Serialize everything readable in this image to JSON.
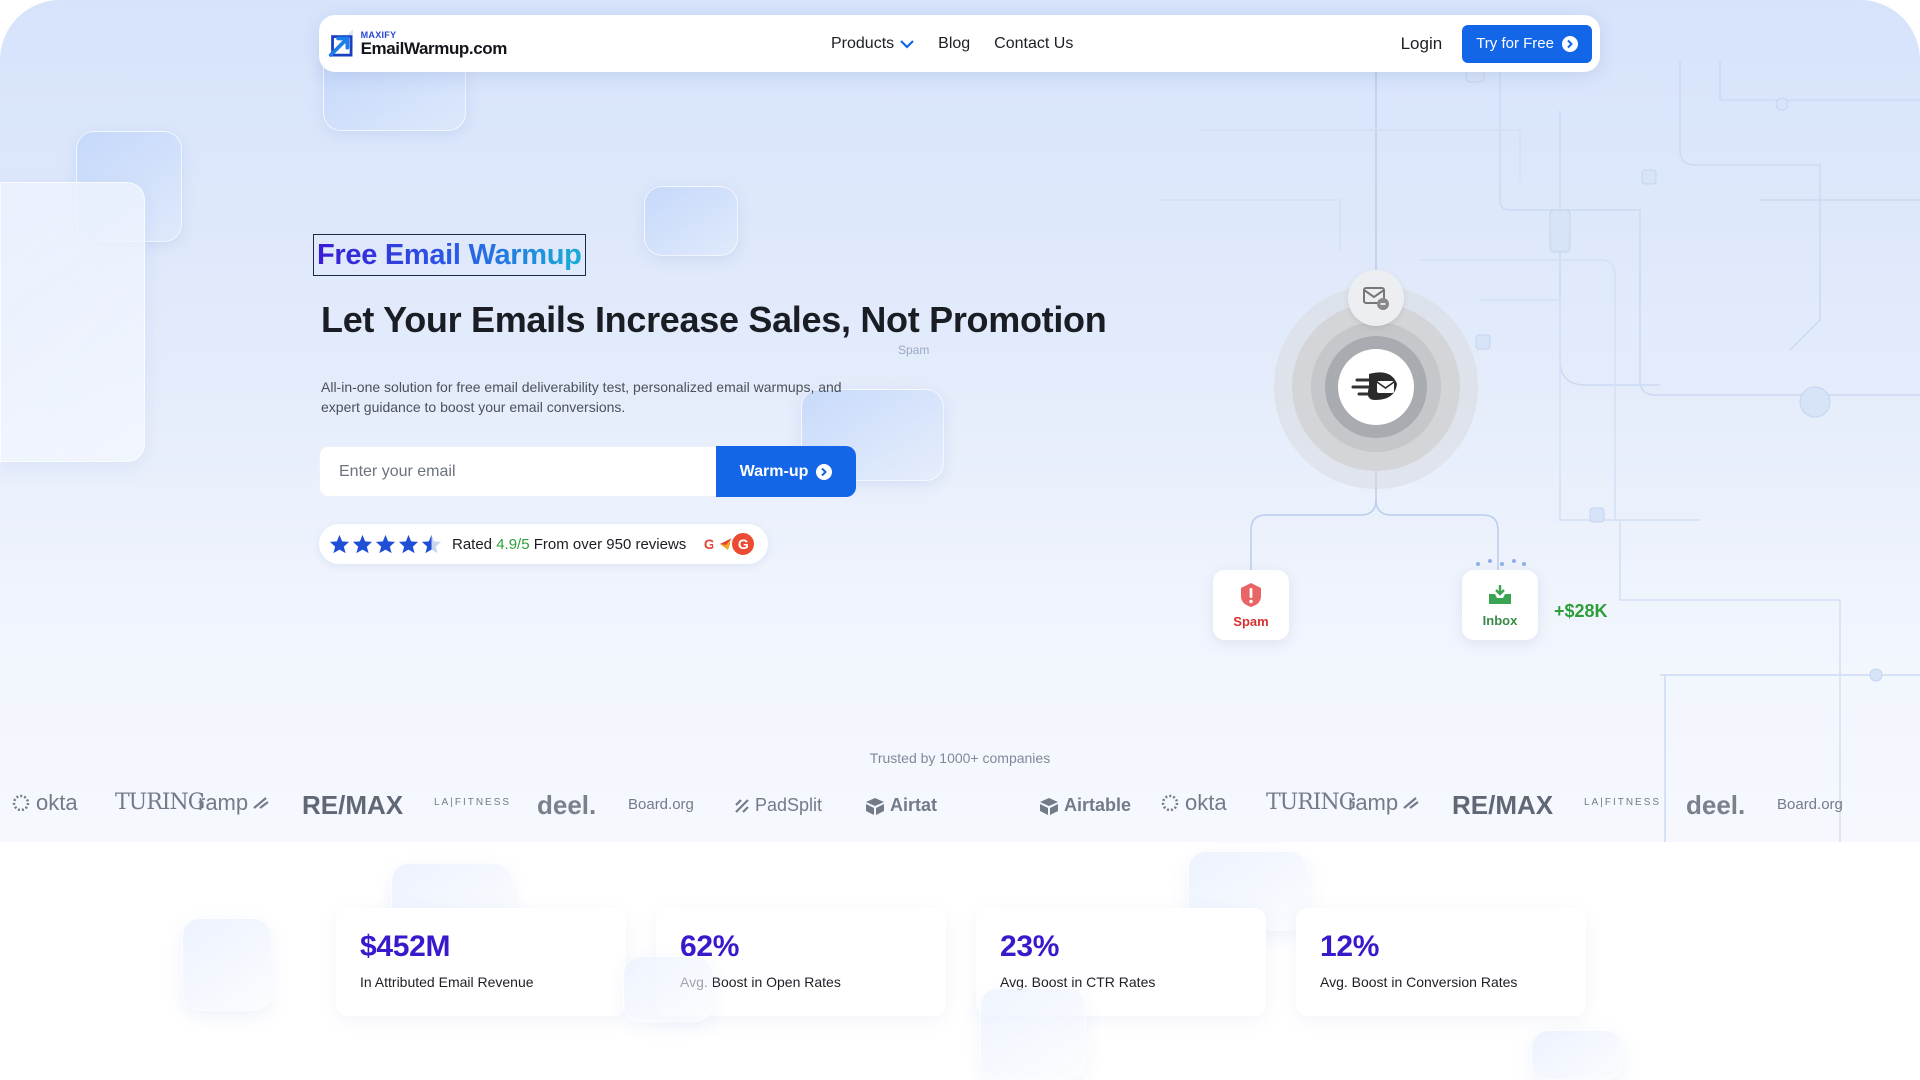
{
  "nav": {
    "logo_small": "MAXIFY",
    "logo_big": "EmailWarmup.com",
    "products": "Products",
    "blog": "Blog",
    "contact": "Contact Us",
    "login": "Login",
    "try_free": "Try for Free"
  },
  "hero": {
    "tagline": "Free Email Warmup",
    "headline": "Let Your Emails Increase Sales, Not Promotion",
    "spam_caption": "Spam",
    "subtitle": "All-in-one solution for free email deliverability test, personalized email warmups, and expert guidance to boost your email conversions.",
    "email_placeholder": "Enter your email",
    "warm_button": "Warm-up",
    "rating_prefix": "Rated",
    "rating_score": "4.9/5",
    "rating_suffix": "From over 950 reviews",
    "rating_stars": 4.5
  },
  "illustration": {
    "spam_label": "Spam",
    "inbox_label": "Inbox",
    "revenue": "+$28K"
  },
  "trusted": {
    "caption": "Trusted by 1000+ companies",
    "logos": [
      "okta",
      "TURING",
      "ramp",
      "RE/MAX",
      "LA|FITNESS",
      "deel.",
      "Board.org",
      "PadSplit",
      "Airtat",
      "Airtable",
      "okta",
      "TURING",
      "ramp",
      "RE/MAX",
      "LA|FITNESS",
      "deel.",
      "Board.org"
    ]
  },
  "stats": [
    {
      "value": "$452M",
      "label": "In Attributed Email Revenue"
    },
    {
      "value": "62%",
      "label": "Avg. Boost in Open Rates"
    },
    {
      "value": "23%",
      "label": "Avg. Boost in CTR Rates"
    },
    {
      "value": "12%",
      "label": "Avg. Boost in Conversion Rates"
    }
  ],
  "colors": {
    "accent": "#1366e8",
    "stat_value": "#3a19cc",
    "success": "#2e9e3a",
    "spam": "#d93030"
  }
}
